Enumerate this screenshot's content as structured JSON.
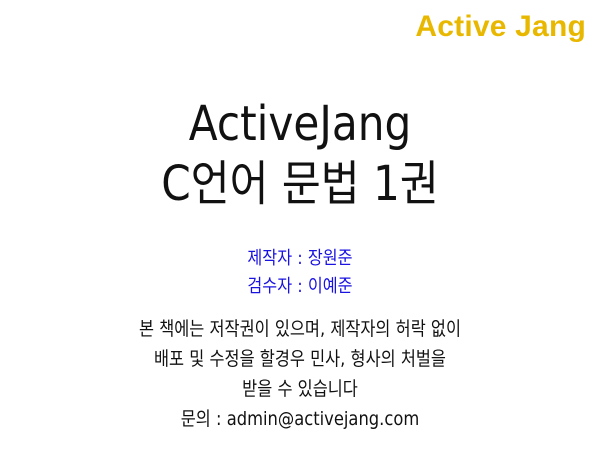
{
  "colors": {
    "brand": "#e8b800",
    "credit": "#1a12e0",
    "text": "#111111",
    "background": "#ffffff"
  },
  "brand": {
    "logo_text": "Active Jang"
  },
  "title": {
    "line1": "ActiveJang",
    "line2": "C언어 문법 1권"
  },
  "credits": {
    "author": "제작자 : 장원준",
    "reviewer": "검수자 : 이예준"
  },
  "notice": {
    "line1": "본 책에는 저작권이 있으며, 제작자의 허락 없이",
    "line2": "배포 및 수정을 할경우 민사, 형사의 처벌을",
    "line3": "받을 수 있습니다",
    "contact": "문의 : admin@activejang.com"
  }
}
